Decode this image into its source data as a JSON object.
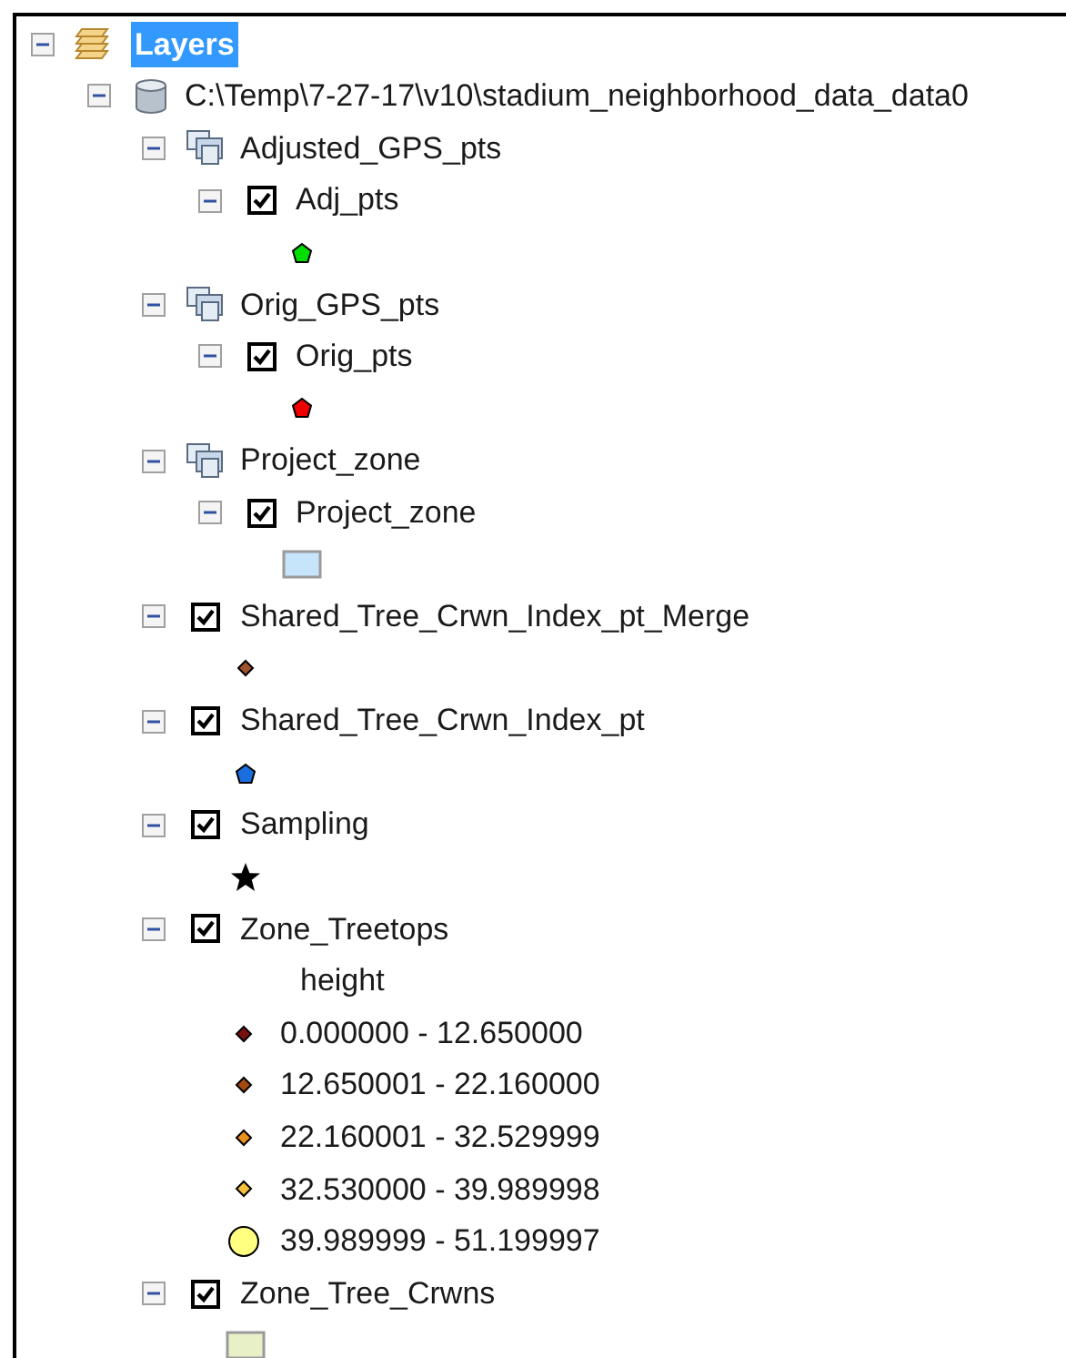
{
  "toc": {
    "root": {
      "label": "Layers",
      "selected": true,
      "expanded": true,
      "children": [
        {
          "kind": "database",
          "label": "C:\\Temp\\7-27-17\\v10\\stadium_neighborhood_data_data0",
          "expanded": true,
          "children": [
            {
              "kind": "group",
              "label": "Adjusted_GPS_pts",
              "expanded": true,
              "children": [
                {
                  "kind": "layer",
                  "label": "Adj_pts",
                  "checked": true,
                  "expanded": true,
                  "legend": [
                    {
                      "kind": "pentagon",
                      "color": "#00dd00"
                    }
                  ]
                }
              ]
            },
            {
              "kind": "group",
              "label": "Orig_GPS_pts",
              "expanded": true,
              "children": [
                {
                  "kind": "layer",
                  "label": "Orig_pts",
                  "checked": true,
                  "expanded": true,
                  "legend": [
                    {
                      "kind": "pentagon",
                      "color": "#ee0000"
                    }
                  ]
                }
              ]
            },
            {
              "kind": "group",
              "label": "Project_zone",
              "expanded": true,
              "children": [
                {
                  "kind": "layer",
                  "label": "Project_zone",
                  "checked": true,
                  "expanded": true,
                  "legend": [
                    {
                      "kind": "polygon",
                      "color": "#c6e4fa"
                    }
                  ]
                }
              ]
            },
            {
              "kind": "layer",
              "label": "Shared_Tree_Crwn_Index_pt_Merge",
              "checked": true,
              "expanded": true,
              "legend": [
                {
                  "kind": "diamond",
                  "color": "#a0522d"
                }
              ]
            },
            {
              "kind": "layer",
              "label": "Shared_Tree_Crwn_Index_pt",
              "checked": true,
              "expanded": true,
              "legend": [
                {
                  "kind": "pentagon",
                  "color": "#1a6fe0"
                }
              ]
            },
            {
              "kind": "layer",
              "label": "Sampling",
              "checked": true,
              "expanded": true,
              "legend": [
                {
                  "kind": "star",
                  "color": "#000000"
                }
              ]
            },
            {
              "kind": "layer",
              "label": "Zone_Treetops",
              "checked": true,
              "expanded": true,
              "legend_heading": "height",
              "legend": [
                {
                  "kind": "diamond",
                  "color": "#7a0f0f",
                  "label": "0.000000 - 12.650000"
                },
                {
                  "kind": "diamond",
                  "color": "#a34a12",
                  "label": "12.650001 - 22.160000"
                },
                {
                  "kind": "diamond",
                  "color": "#e8901e",
                  "label": "22.160001 - 32.529999"
                },
                {
                  "kind": "diamond",
                  "color": "#f6c13a",
                  "label": "32.530000 - 39.989998"
                },
                {
                  "kind": "circle",
                  "color": "#ffff80",
                  "label": "39.989999 - 51.199997"
                }
              ]
            },
            {
              "kind": "layer",
              "label": "Zone_Tree_Crwns",
              "checked": true,
              "expanded": true,
              "legend": [
                {
                  "kind": "polygon",
                  "color": "#e8f0c8"
                }
              ]
            }
          ]
        }
      ]
    }
  }
}
